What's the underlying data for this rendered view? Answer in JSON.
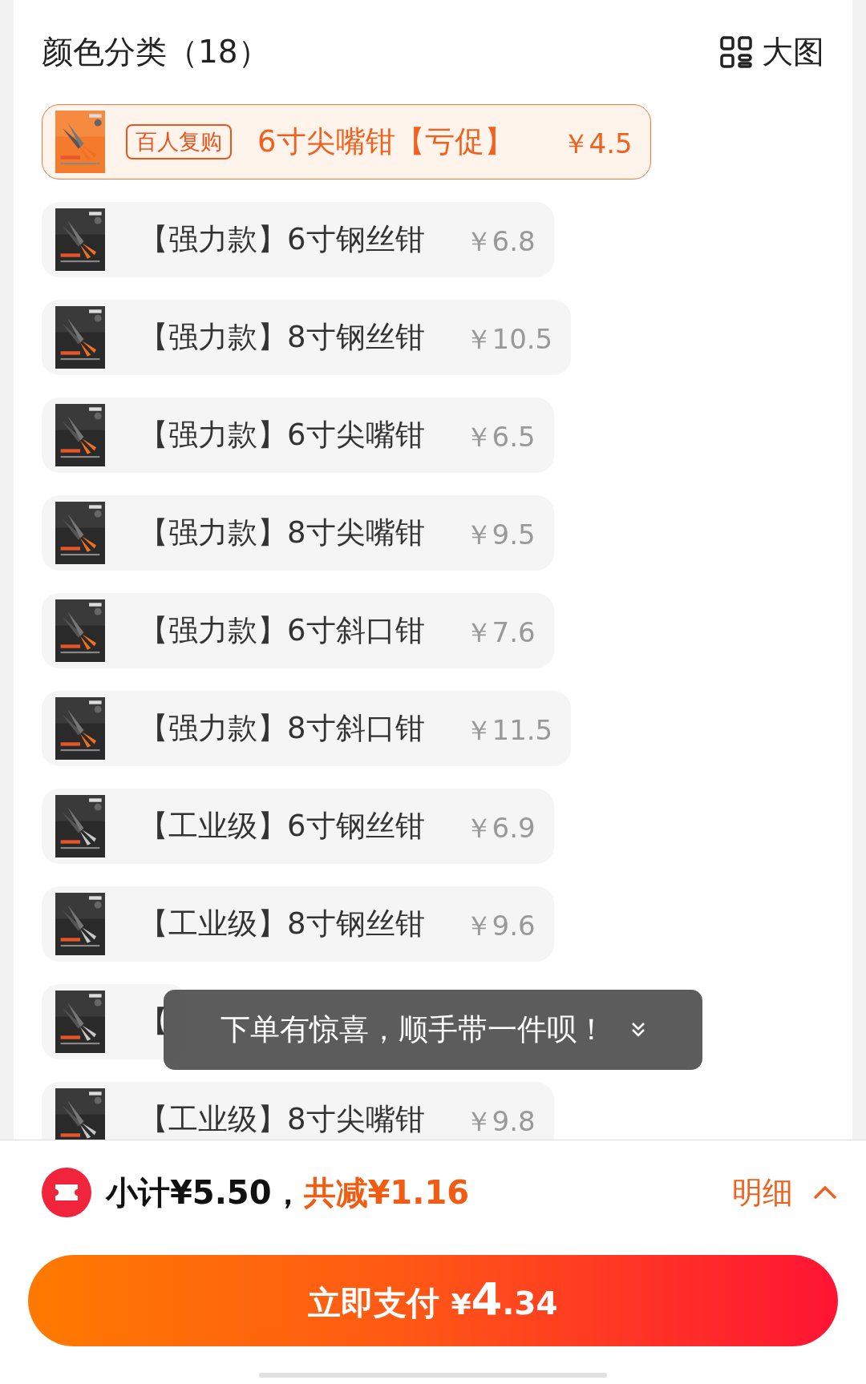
{
  "header": {
    "title": "颜色分类（18）",
    "view_toggle": "大图"
  },
  "options": [
    {
      "label": "6寸尖嘴钳【亏促】",
      "price": "￥4.5",
      "badge": "百人复购",
      "selected": true
    },
    {
      "label": "【强力款】6寸钢丝钳",
      "price": "￥6.8",
      "selected": false
    },
    {
      "label": "【强力款】8寸钢丝钳",
      "price": "￥10.5",
      "selected": false
    },
    {
      "label": "【强力款】6寸尖嘴钳",
      "price": "￥6.5",
      "selected": false
    },
    {
      "label": "【强力款】8寸尖嘴钳",
      "price": "￥9.5",
      "selected": false
    },
    {
      "label": "【强力款】6寸斜口钳",
      "price": "￥7.6",
      "selected": false
    },
    {
      "label": "【强力款】8寸斜口钳",
      "price": "￥11.5",
      "selected": false
    },
    {
      "label": "【工业级】6寸钢丝钳",
      "price": "￥6.9",
      "selected": false
    },
    {
      "label": "【工业级】8寸钢丝钳",
      "price": "￥9.6",
      "selected": false
    },
    {
      "label": "【",
      "selected": false
    },
    {
      "label": "【工业级】8寸尖嘴钳",
      "price": "￥9.8",
      "selected": false
    }
  ],
  "toast": {
    "text": "下单有惊喜，顺手带一件呗！"
  },
  "summary": {
    "subtotal": "小计¥5.50，",
    "discount": "共减¥1.16",
    "details": "明细"
  },
  "pay_button": {
    "label": "立即支付",
    "currency": "¥",
    "amount_int": "4",
    "amount_dec": ".34"
  }
}
